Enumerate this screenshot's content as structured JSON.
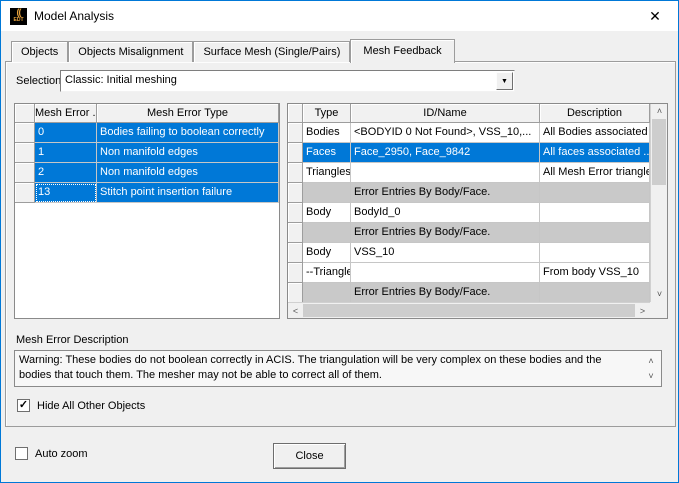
{
  "window": {
    "title": "Model Analysis",
    "app_icon_text": "EDT",
    "app_icon_arcs": "(("
  },
  "icons": {
    "close": "✕",
    "dropdown": "▼",
    "scroll_up": "˄",
    "scroll_down": "˅",
    "scroll_left": "˂",
    "scroll_right": "˃",
    "check": "✓"
  },
  "tabs": [
    {
      "label": "Objects",
      "active": false
    },
    {
      "label": "Objects Misalignment",
      "active": false
    },
    {
      "label": "Surface Mesh (Single/Pairs)",
      "active": false
    },
    {
      "label": "Mesh Feedback",
      "active": true
    }
  ],
  "selection": {
    "label": "Selection:",
    "value": "Classic: Initial meshing"
  },
  "left_table": {
    "columns": [
      "Mesh Error ...",
      "Mesh Error Type"
    ],
    "rows": [
      {
        "num": "0",
        "type": "Bodies failing to boolean correctly",
        "selected": true
      },
      {
        "num": "1",
        "type": "Non manifold edges",
        "selected": true
      },
      {
        "num": "2",
        "type": "Non manifold edges",
        "selected": true
      },
      {
        "num": "13",
        "type": "Stitch point insertion failure",
        "selected": true,
        "focus": true
      }
    ]
  },
  "right_table": {
    "columns": [
      "Type",
      "ID/Name",
      "Description"
    ],
    "rows": [
      {
        "type": "Bodies",
        "id": "<BODYID 0 Not Found>, VSS_10,...",
        "desc": "All Bodies associated"
      },
      {
        "type": "Faces",
        "id": "Face_2950, Face_9842",
        "desc": "All faces associated ..",
        "selected": true
      },
      {
        "type": "Triangles",
        "id": "",
        "desc": "All Mesh Error triangle."
      },
      {
        "type": "",
        "id": "Error Entries By Body/Face.",
        "desc": "",
        "section": true
      },
      {
        "type": "Body",
        "id": "BodyId_0",
        "desc": ""
      },
      {
        "type": "",
        "id": "Error Entries By Body/Face.",
        "desc": "",
        "section": true
      },
      {
        "type": "Body",
        "id": "VSS_10",
        "desc": ""
      },
      {
        "type": "--Triangles",
        "id": "",
        "desc": "From body VSS_10"
      },
      {
        "type": "",
        "id": "Error Entries By Body/Face.",
        "desc": "",
        "section": true
      }
    ]
  },
  "description": {
    "label": "Mesh Error Description",
    "text": "Warning:  These bodies do not boolean correctly in ACIS.  The triangulation will be very complex on these bodies and the bodies that touch them.  The mesher may not be able to correct all of them."
  },
  "checkboxes": {
    "hide_all_label": "Hide All Other Objects",
    "hide_all_checked": true,
    "auto_zoom_label": "Auto zoom",
    "auto_zoom_checked": false
  },
  "buttons": {
    "close_label": "Close"
  },
  "colors": {
    "accent": "#0078d7",
    "selection": "#0078d7",
    "section_row": "#c9c9c9",
    "titlebar": "#ffffff",
    "dialog_bg": "#f0f0f0"
  }
}
